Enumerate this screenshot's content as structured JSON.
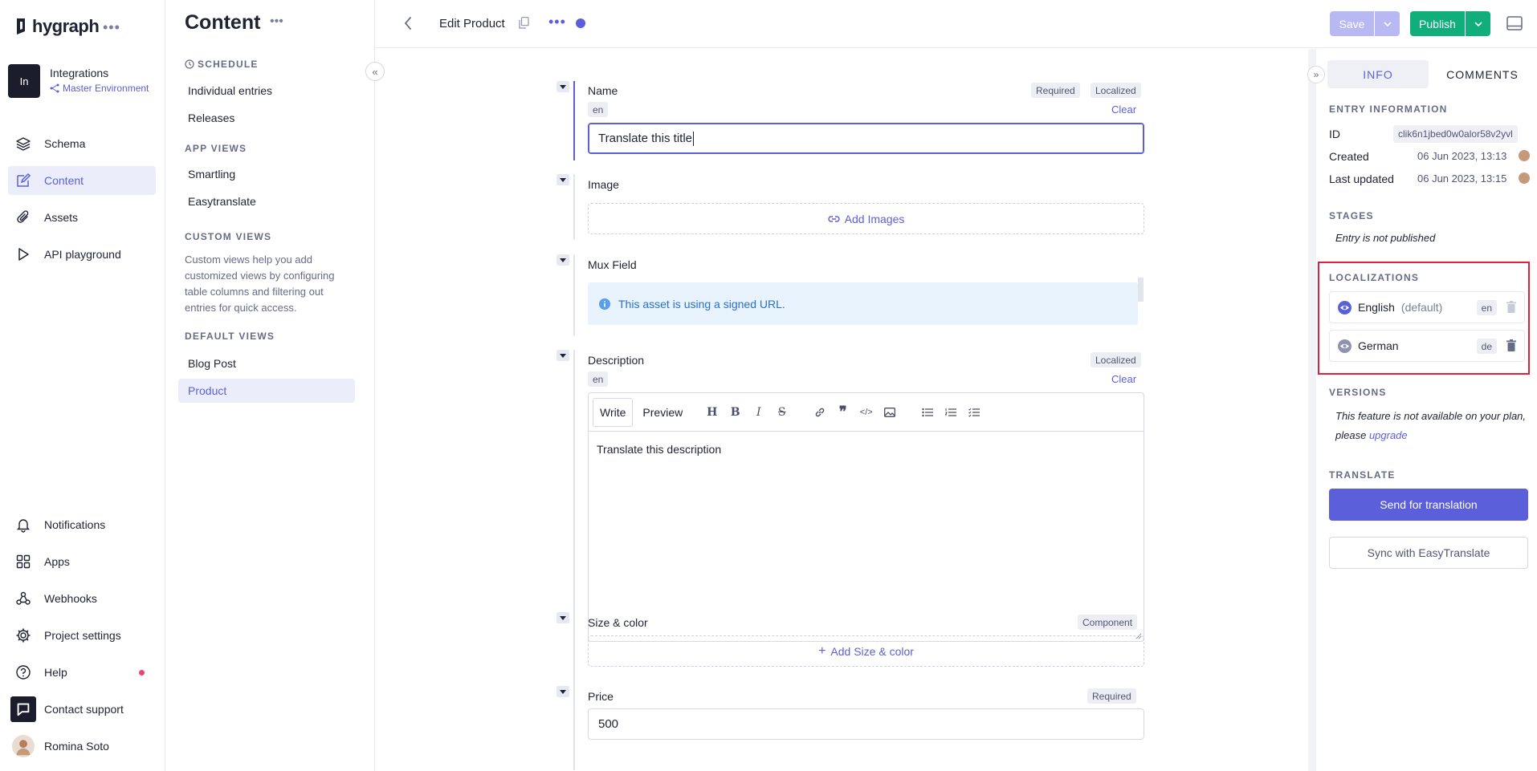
{
  "brand": {
    "name": "hygraph"
  },
  "project": {
    "initials": "In",
    "name": "Integrations",
    "environment": "Master Environment"
  },
  "nav": {
    "top": [
      {
        "label": "Schema",
        "icon": "layers-icon"
      },
      {
        "label": "Content",
        "icon": "edit-icon",
        "active": true
      },
      {
        "label": "Assets",
        "icon": "paperclip-icon"
      },
      {
        "label": "API playground",
        "icon": "play-icon"
      }
    ],
    "bottom": [
      {
        "label": "Notifications",
        "icon": "bell-icon"
      },
      {
        "label": "Apps",
        "icon": "apps-grid-icon"
      },
      {
        "label": "Webhooks",
        "icon": "webhook-icon"
      },
      {
        "label": "Project settings",
        "icon": "gear-icon"
      },
      {
        "label": "Help",
        "icon": "help-circle-icon"
      },
      {
        "label": "Contact support",
        "icon": "chat-icon"
      },
      {
        "label": "Romina Soto",
        "icon": "user-avatar"
      }
    ]
  },
  "content_sidebar": {
    "title": "Content",
    "schedule": {
      "heading": "SCHEDULE",
      "items": [
        "Individual entries",
        "Releases"
      ]
    },
    "app_views": {
      "heading": "APP VIEWS",
      "items": [
        "Smartling",
        "Easytranslate"
      ]
    },
    "custom_views": {
      "heading": "CUSTOM VIEWS",
      "text": "Custom views help you add customized views by configuring table columns and filtering out entries for quick access."
    },
    "default_views": {
      "heading": "DEFAULT VIEWS",
      "items": [
        "Blog Post",
        "Product"
      ],
      "active": "Product"
    }
  },
  "header": {
    "title": "Edit Product",
    "save_label": "Save",
    "publish_label": "Publish"
  },
  "fields": {
    "name": {
      "label": "Name",
      "tags": [
        "Required",
        "Localized"
      ],
      "locale": "en",
      "clear": "Clear",
      "value": "Translate this title"
    },
    "image": {
      "label": "Image",
      "action": "Add Images"
    },
    "mux": {
      "label": "Mux Field",
      "info": "This asset is using a signed URL."
    },
    "description": {
      "label": "Description",
      "tags": [
        "Localized"
      ],
      "locale": "en",
      "clear": "Clear",
      "tabs": [
        "Write",
        "Preview"
      ],
      "value": "Translate this description"
    },
    "size_color": {
      "label": "Size & color",
      "tags": [
        "Component"
      ],
      "action": "Add Size & color"
    },
    "price": {
      "label": "Price",
      "tags": [
        "Required"
      ],
      "value": "500"
    }
  },
  "right_panel": {
    "tabs": [
      "INFO",
      "COMMENTS"
    ],
    "entry_info": {
      "heading": "ENTRY INFORMATION",
      "id_label": "ID",
      "id_value": "clik6n1jbed0w0alor58v2yvl",
      "created_label": "Created",
      "created_value": "06 Jun 2023, 13:13",
      "updated_label": "Last updated",
      "updated_value": "06 Jun 2023, 13:15"
    },
    "stages": {
      "heading": "STAGES",
      "text": "Entry is not published"
    },
    "localizations": {
      "heading": "LOCALIZATIONS",
      "items": [
        {
          "name": "English",
          "note": "(default)",
          "code": "en"
        },
        {
          "name": "German",
          "note": "",
          "code": "de"
        }
      ]
    },
    "versions": {
      "heading": "VERSIONS",
      "text_line1": "This feature is not available on your plan,",
      "text_line2": "please",
      "link": "upgrade"
    },
    "translate": {
      "heading": "TRANSLATE",
      "primary": "Send for translation",
      "secondary": "Sync with EasyTranslate"
    }
  },
  "colors": {
    "accent": "#5b5fd9",
    "publish": "#0fae7a",
    "highlight": "#e0203a"
  }
}
